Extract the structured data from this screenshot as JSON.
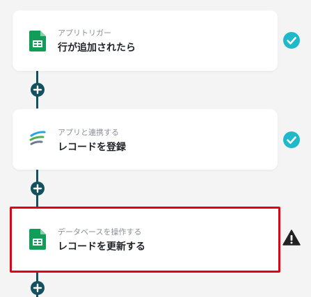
{
  "steps": [
    {
      "subtitle": "アプリトリガー",
      "title": "行が追加されたら",
      "app_icon": "google-sheets-icon",
      "status": "check-circle-icon"
    },
    {
      "subtitle": "アプリと連携する",
      "title": "レコードを登録",
      "app_icon": "kintone-icon",
      "status": "check-circle-icon"
    },
    {
      "subtitle": "データベースを操作する",
      "title": "レコードを更新する",
      "app_icon": "google-sheets-icon",
      "status": "warning-icon"
    }
  ],
  "colors": {
    "background": "#f4f4f5",
    "check": "#1fb9c9",
    "connector": "#14515f",
    "selected_border": "#e60012",
    "sheets_green": "#0f9d58"
  }
}
